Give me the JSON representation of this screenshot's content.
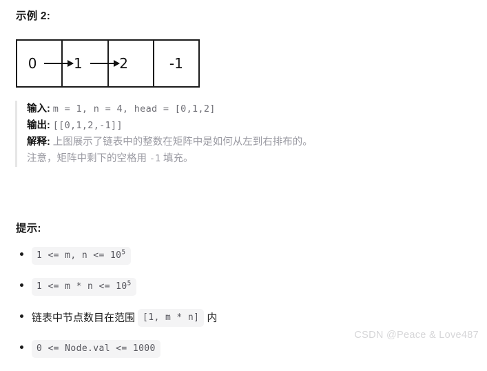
{
  "example": {
    "title": "示例 2:",
    "figure": {
      "cells": [
        {
          "value": "0",
          "arrow_to_next": true
        },
        {
          "value": "1",
          "arrow_to_next": true
        },
        {
          "value": "2",
          "arrow_to_next": false
        },
        {
          "value": "-1",
          "arrow_to_next": false
        }
      ]
    },
    "io": {
      "input_label": "输入:",
      "input_value": "m = 1, n = 4, head = [0,1,2]",
      "output_label": "输出:",
      "output_value": "[[0,1,2,-1]]",
      "explanation_label": "解释:",
      "explanation_text": "上图展示了链表中的整数在矩阵中是如何从左到右排布的。",
      "note_prefix": "注意，矩阵中剩下的空格用",
      "note_code": "-1",
      "note_suffix": "填充。"
    }
  },
  "hints": {
    "title": "提示:",
    "items": [
      {
        "kind": "code",
        "code_prefix": "1 <= m, n <= 10",
        "code_sup": "5"
      },
      {
        "kind": "code",
        "code_prefix": "1 <= m * n <= 10",
        "code_sup": "5"
      },
      {
        "kind": "mixed",
        "text_before": "链表中节点数目在范围",
        "code": "[1, m * n]",
        "text_after": "内"
      },
      {
        "kind": "code",
        "code_prefix": "0 <= Node.val <= 1000",
        "code_sup": ""
      }
    ]
  },
  "watermark": {
    "text": "CSDN @Peace & Love487"
  },
  "colors": {
    "figure_border": "#1b1b1b",
    "quote_border": "#e6e6e6",
    "code_background": "#f4f4f5",
    "muted_text": "#9a9aa2",
    "watermark": "#d6d6d8"
  }
}
